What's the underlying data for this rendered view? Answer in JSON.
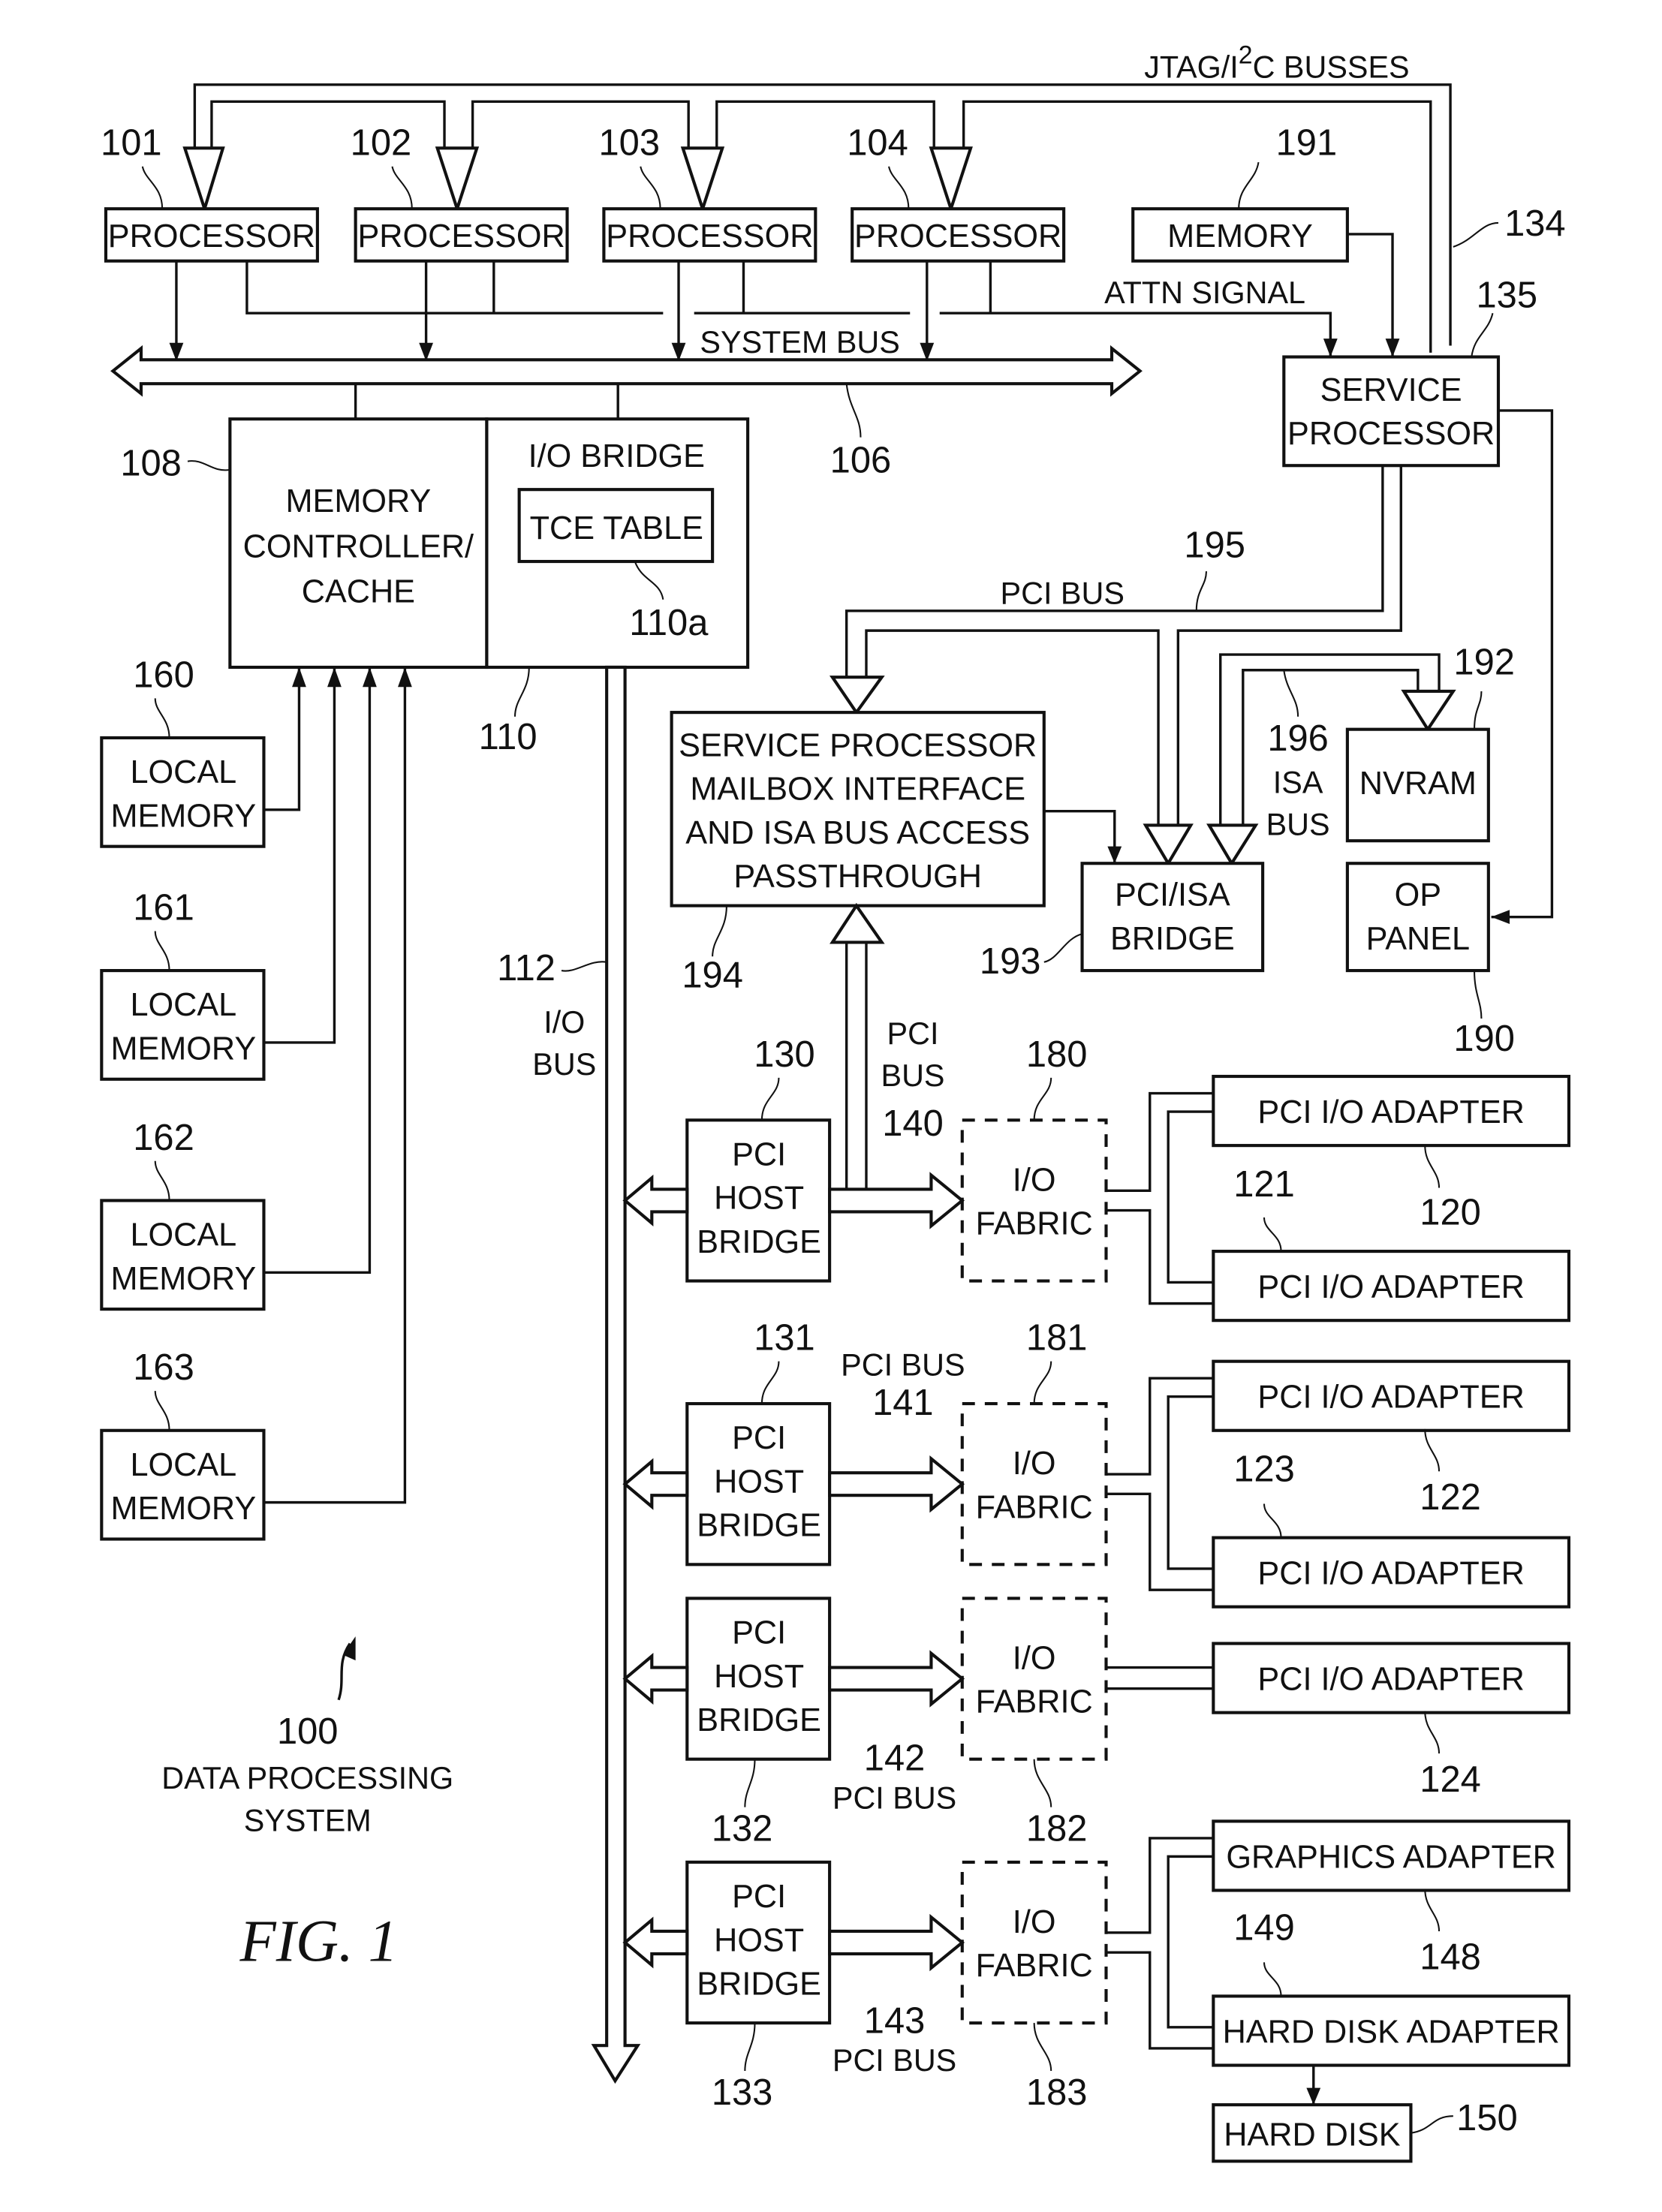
{
  "figure": {
    "title": "FIG. 1",
    "system_ref": "100",
    "system_name_line1": "DATA PROCESSING",
    "system_name_line2": "SYSTEM"
  },
  "bus_labels": {
    "jtag": "JTAG/I",
    "jtag_sup": "2",
    "jtag_rest": "C BUSSES",
    "jtag_ref": "134",
    "system_bus": "SYSTEM BUS",
    "system_bus_ref": "106",
    "attn_signal": "ATTN SIGNAL",
    "pci_bus_top": "PCI BUS",
    "pci_bus_top_ref": "195",
    "isa_bus_ref": "196",
    "isa_bus_line1": "ISA",
    "isa_bus_line2": "BUS",
    "io_bus_ref": "112",
    "io_bus_line1": "I/O",
    "io_bus_line2": "BUS",
    "pci_bus_140_line1": "PCI",
    "pci_bus_140_line2": "BUS",
    "pci_bus_140_ref": "140",
    "pci_bus_141": "PCI BUS",
    "pci_bus_141_ref": "141",
    "pci_bus_142": "PCI BUS",
    "pci_bus_142_ref": "142",
    "pci_bus_143": "PCI BUS",
    "pci_bus_143_ref": "143"
  },
  "processors": [
    {
      "ref": "101",
      "label": "PROCESSOR"
    },
    {
      "ref": "102",
      "label": "PROCESSOR"
    },
    {
      "ref": "103",
      "label": "PROCESSOR"
    },
    {
      "ref": "104",
      "label": "PROCESSOR"
    }
  ],
  "memory": {
    "ref": "191",
    "label": "MEMORY"
  },
  "service_processor": {
    "ref": "135",
    "line1": "SERVICE",
    "line2": "PROCESSOR"
  },
  "memory_controller": {
    "ref": "108",
    "line1": "MEMORY",
    "line2": "CONTROLLER/",
    "line3": "CACHE"
  },
  "io_bridge": {
    "ref": "110",
    "label": "I/O BRIDGE"
  },
  "tce_table": {
    "ref": "110a",
    "label": "TCE TABLE"
  },
  "local_memories": [
    {
      "ref": "160",
      "line1": "LOCAL",
      "line2": "MEMORY"
    },
    {
      "ref": "161",
      "line1": "LOCAL",
      "line2": "MEMORY"
    },
    {
      "ref": "162",
      "line1": "LOCAL",
      "line2": "MEMORY"
    },
    {
      "ref": "163",
      "line1": "LOCAL",
      "line2": "MEMORY"
    }
  ],
  "mailbox": {
    "ref": "194",
    "line1": "SERVICE PROCESSOR",
    "line2": "MAILBOX INTERFACE",
    "line3": "AND ISA BUS ACCESS",
    "line4": "PASSTHROUGH"
  },
  "pci_isa_bridge": {
    "ref": "193",
    "line1": "PCI/ISA",
    "line2": "BRIDGE"
  },
  "nvram": {
    "ref": "192",
    "label": "NVRAM"
  },
  "op_panel": {
    "ref": "190",
    "line1": "OP",
    "line2": "PANEL"
  },
  "host_bridges": [
    {
      "ref": "130",
      "line1": "PCI",
      "line2": "HOST",
      "line3": "BRIDGE"
    },
    {
      "ref": "131",
      "line1": "PCI",
      "line2": "HOST",
      "line3": "BRIDGE"
    },
    {
      "ref": "132",
      "line1": "PCI",
      "line2": "HOST",
      "line3": "BRIDGE"
    },
    {
      "ref": "133",
      "line1": "PCI",
      "line2": "HOST",
      "line3": "BRIDGE"
    }
  ],
  "io_fabrics": [
    {
      "ref": "180",
      "line1": "I/O",
      "line2": "FABRIC"
    },
    {
      "ref": "181",
      "line1": "I/O",
      "line2": "FABRIC"
    },
    {
      "ref": "182",
      "line1": "I/O",
      "line2": "FABRIC"
    },
    {
      "ref": "183",
      "line1": "I/O",
      "line2": "FABRIC"
    }
  ],
  "adapters": [
    {
      "ref": "120",
      "label": "PCI I/O ADAPTER"
    },
    {
      "ref": "121",
      "label": "PCI I/O ADAPTER"
    },
    {
      "ref": "122",
      "label": "PCI I/O ADAPTER"
    },
    {
      "ref": "123",
      "label": "PCI I/O ADAPTER"
    },
    {
      "ref": "124",
      "label": "PCI I/O ADAPTER"
    },
    {
      "ref": "148",
      "label": "GRAPHICS ADAPTER"
    },
    {
      "ref": "149",
      "label": "HARD DISK ADAPTER"
    }
  ],
  "hard_disk": {
    "ref": "150",
    "label": "HARD DISK"
  }
}
